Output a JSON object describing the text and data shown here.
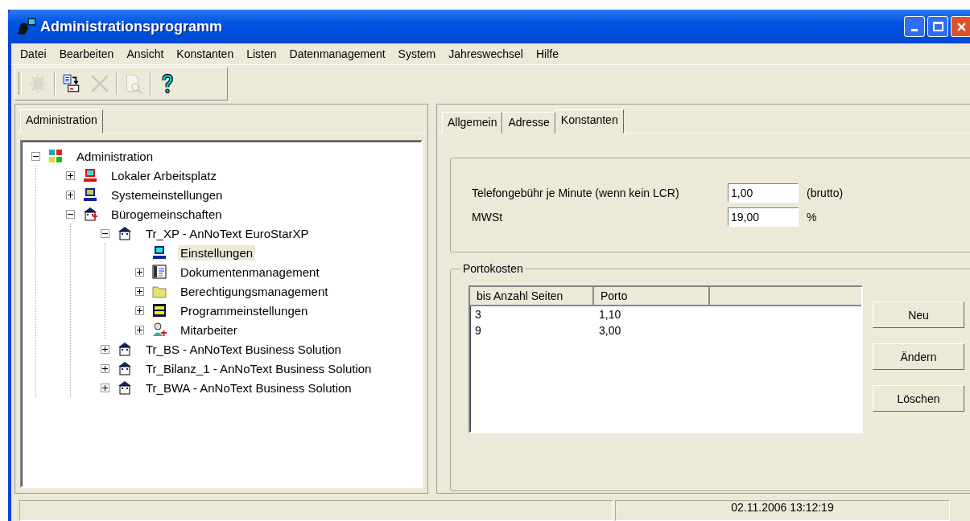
{
  "window": {
    "title": "Administrationsprogramm"
  },
  "menu": [
    "Datei",
    "Bearbeiten",
    "Ansicht",
    "Konstanten",
    "Listen",
    "Datenmanagement",
    "System",
    "Jahreswechsel",
    "Hilfe"
  ],
  "toolbar": [
    {
      "kind": "new",
      "disabled": true
    },
    {
      "kind": "copy",
      "disabled": false
    },
    {
      "kind": "delete",
      "disabled": true
    },
    {
      "kind": "preview",
      "disabled": true
    },
    {
      "kind": "help",
      "disabled": false
    }
  ],
  "left_tabs": [
    {
      "label": "Administration",
      "selected": true
    }
  ],
  "tree": [
    {
      "label": "Administration",
      "kind": "network",
      "expanded": true,
      "selected": false,
      "children": [
        {
          "label": "Lokaler Arbeitsplatz",
          "kind": "pc-red",
          "expanded": false,
          "selected": false
        },
        {
          "label": "Systemeinstellungen",
          "kind": "pc-blue",
          "expanded": false,
          "selected": false
        },
        {
          "label": "Bürogemeinschaften",
          "kind": "building-plus",
          "expanded": true,
          "selected": false,
          "children": [
            {
              "label": "Tr_XP - AnNoText EuroStarXP",
              "kind": "building",
              "expanded": true,
              "selected": false,
              "children": [
                {
                  "label": "Einstellungen",
                  "kind": "pc",
                  "selected": true
                },
                {
                  "label": "Dokumentenmanagement",
                  "kind": "document",
                  "expanded": false,
                  "selected": false
                },
                {
                  "label": "Berechtigungsmanagement",
                  "kind": "folder",
                  "expanded": false,
                  "selected": false
                },
                {
                  "label": "Programmeinstellungen",
                  "kind": "settings",
                  "expanded": false,
                  "selected": false
                },
                {
                  "label": "Mitarbeiter",
                  "kind": "person",
                  "expanded": false,
                  "selected": false
                }
              ]
            },
            {
              "label": "Tr_BS - AnNoText Business Solution",
              "kind": "building",
              "expanded": false,
              "selected": false
            },
            {
              "label": "Tr_Bilanz_1 - AnNoText Business Solution",
              "kind": "building",
              "expanded": false,
              "selected": false
            },
            {
              "label": "Tr_BWA - AnNoText Business Solution",
              "kind": "building",
              "expanded": false,
              "selected": false
            }
          ]
        }
      ]
    }
  ],
  "right_tabs": [
    {
      "label": "Allgemein",
      "selected": false
    },
    {
      "label": "Adresse",
      "selected": false
    },
    {
      "label": "Konstanten",
      "selected": true
    }
  ],
  "constants": [
    {
      "label": "Telefongebühr je Minute (wenn kein LCR)",
      "value": "1,00",
      "unit": "(brutto)"
    },
    {
      "label": "MWSt",
      "value": "19,00",
      "unit": "%"
    }
  ],
  "portokosten": {
    "title": "Portokosten",
    "columns": [
      "bis Anzahl Seiten",
      "Porto"
    ],
    "rows": [
      [
        "3",
        "1,10"
      ],
      [
        "9",
        "3,00"
      ]
    ],
    "buttons": [
      "Neu",
      "Ändern",
      "Löschen"
    ]
  },
  "status_bar": {
    "datetime": "02.11.2006 13:12:19"
  }
}
